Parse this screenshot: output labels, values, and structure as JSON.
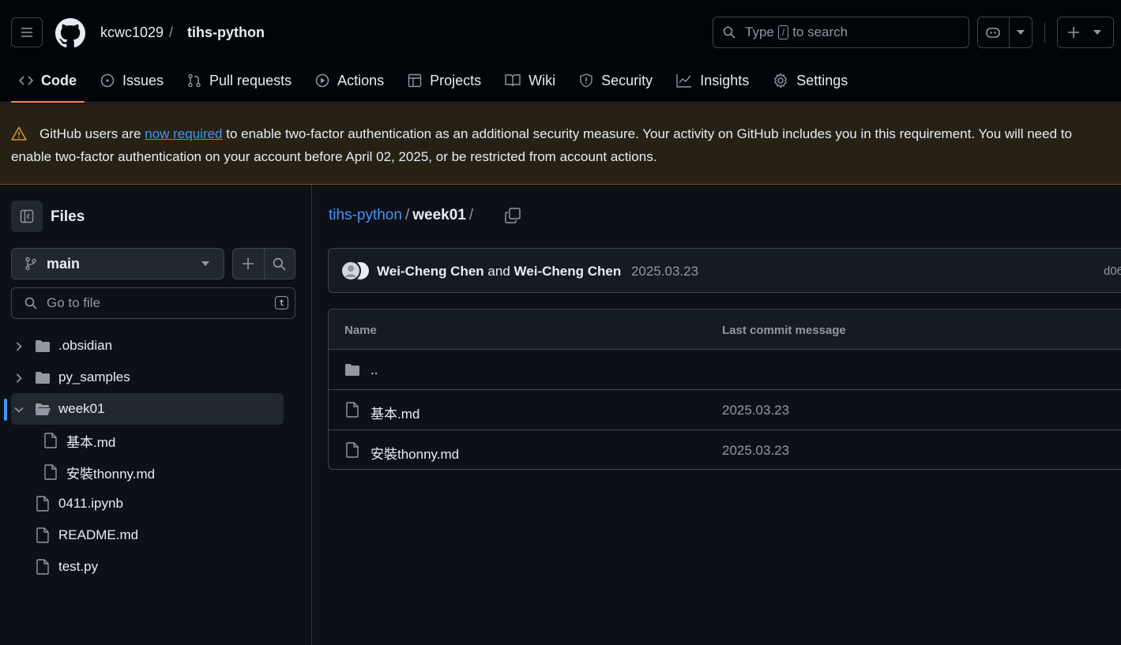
{
  "header": {
    "owner": "kcwc1029",
    "separator": "/",
    "repo": "tihs-python",
    "search_prefix": "Type",
    "search_key": "/",
    "search_suffix": "to search"
  },
  "tabs": [
    {
      "label": "Code",
      "icon": "code-icon"
    },
    {
      "label": "Issues",
      "icon": "issue-icon"
    },
    {
      "label": "Pull requests",
      "icon": "pull-request-icon"
    },
    {
      "label": "Actions",
      "icon": "play-icon"
    },
    {
      "label": "Projects",
      "icon": "table-icon"
    },
    {
      "label": "Wiki",
      "icon": "book-icon"
    },
    {
      "label": "Security",
      "icon": "shield-icon"
    },
    {
      "label": "Insights",
      "icon": "graph-icon"
    },
    {
      "label": "Settings",
      "icon": "gear-icon"
    }
  ],
  "banner": {
    "text_before": "GitHub users are ",
    "link": "now required",
    "text_after": " to enable two-factor authentication as an additional security measure. Your activity on GitHub includes you in this requirement. You will need to enable two-factor authentication on your account before April 02, 2025, or be restricted from account actions."
  },
  "sidebar": {
    "title": "Files",
    "branch": "main",
    "goto_placeholder": "Go to file",
    "goto_key": "t",
    "tree": [
      {
        "name": ".obsidian",
        "type": "folder"
      },
      {
        "name": "py_samples",
        "type": "folder"
      },
      {
        "name": "week01",
        "type": "folder-open"
      },
      {
        "name": "基本.md",
        "type": "file"
      },
      {
        "name": "安裝thonny.md",
        "type": "file"
      },
      {
        "name": "0411.ipynb",
        "type": "file"
      },
      {
        "name": "README.md",
        "type": "file"
      },
      {
        "name": "test.py",
        "type": "file"
      }
    ]
  },
  "main": {
    "breadcrumb_repo": "tihs-python",
    "breadcrumb_sep": "/",
    "breadcrumb_dir": "week01",
    "commit": {
      "author1": "Wei-Cheng Chen",
      "conj": "and",
      "author2": "Wei-Cheng Chen",
      "date": "2025.03.23",
      "sha": "d06"
    },
    "table": {
      "col_name": "Name",
      "col_message": "Last commit message",
      "parent": "..",
      "rows": [
        {
          "name": "基本.md",
          "message": "2025.03.23"
        },
        {
          "name": "安裝thonny.md",
          "message": "2025.03.23"
        }
      ]
    }
  }
}
